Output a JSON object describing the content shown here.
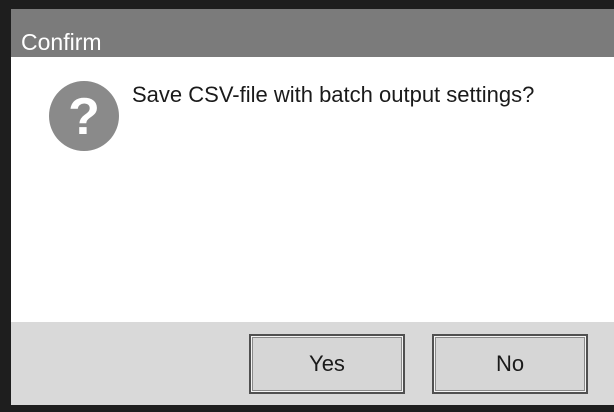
{
  "dialog": {
    "title": "Confirm",
    "icon": "question-icon",
    "icon_glyph": "?",
    "message": "Save CSV-file with batch output settings?",
    "buttons": {
      "yes_label": "Yes",
      "no_label": "No"
    }
  },
  "colors": {
    "titlebar": "#7b7b7b",
    "icon": "#8a8a8a",
    "footer": "#d9d9d9"
  }
}
